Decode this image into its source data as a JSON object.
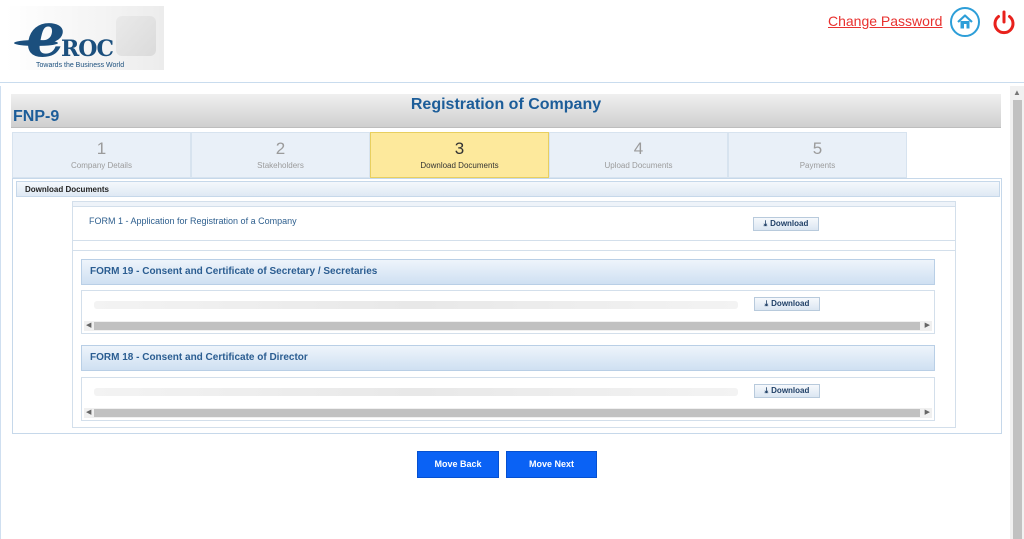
{
  "header": {
    "logo_text": "eROC",
    "logo_tagline": "Towards the Business World",
    "change_password": "Change Password",
    "home_icon": "home-icon",
    "power_icon": "power-icon"
  },
  "form": {
    "code": "FNP-9",
    "title": "Registration of Company"
  },
  "steps": [
    {
      "num": "1",
      "label": "Company Details"
    },
    {
      "num": "2",
      "label": "Stakeholders"
    },
    {
      "num": "3",
      "label": "Download Documents"
    },
    {
      "num": "4",
      "label": "Upload Documents"
    },
    {
      "num": "5",
      "label": "Payments"
    }
  ],
  "active_step": "3",
  "download_section": {
    "header": "Download Documents",
    "form1": "FORM 1 - Application for Registration of a Company",
    "form19": "FORM 19 - Consent and Certificate of Secretary / Secretaries",
    "form18": "FORM 18 - Consent and Certificate of Director",
    "download_label": "Download",
    "download_icon": "download-icon"
  },
  "buttons": {
    "back": "Move Back",
    "next": "Move Next"
  },
  "colors": {
    "accent_blue": "#1c5d99",
    "active_step": "#fde99c",
    "primary_button": "#0a62f5",
    "link_red": "#e8312f"
  }
}
